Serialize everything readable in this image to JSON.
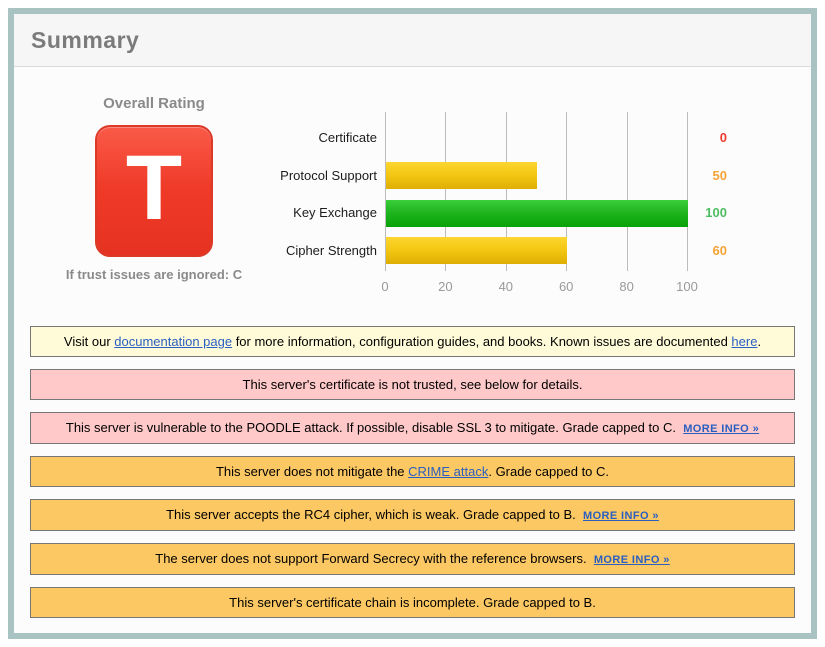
{
  "header": {
    "title": "Summary"
  },
  "rating": {
    "title": "Overall Rating",
    "grade": "T",
    "caption": "If trust issues are ignored: C",
    "badge_color_top": "#fa5a49",
    "badge_color_bottom": "#e63221"
  },
  "chart_data": {
    "type": "bar",
    "orientation": "horizontal",
    "categories": [
      "Certificate",
      "Protocol Support",
      "Key Exchange",
      "Cipher Strength"
    ],
    "values": [
      0,
      50,
      100,
      60
    ],
    "value_label_colors": [
      "#ee3b2c",
      "#f5a335",
      "#4cbd63",
      "#f5a335"
    ],
    "bar_styles": [
      "none",
      "yellow",
      "green",
      "yellow"
    ],
    "xticks": [
      0,
      20,
      40,
      60,
      80,
      100
    ],
    "xlim": [
      0,
      100
    ],
    "grid": true,
    "title": "",
    "xlabel": "",
    "ylabel": ""
  },
  "messages": [
    {
      "type": "info",
      "segments": [
        {
          "text": "Visit our "
        },
        {
          "text": "documentation page",
          "link": true
        },
        {
          "text": " for more information, configuration guides, and books. Known issues are documented "
        },
        {
          "text": "here",
          "link": true
        },
        {
          "text": "."
        }
      ]
    },
    {
      "type": "error",
      "segments": [
        {
          "text": "This server's certificate is not trusted, see below for details."
        }
      ]
    },
    {
      "type": "error",
      "segments": [
        {
          "text": "This server is vulnerable to the POODLE attack. If possible, disable SSL 3 to mitigate. Grade capped to C.  "
        },
        {
          "text": "MORE INFO »",
          "link": true,
          "more_info": true
        }
      ]
    },
    {
      "type": "warning",
      "segments": [
        {
          "text": "This server does not mitigate the "
        },
        {
          "text": "CRIME attack",
          "link": true
        },
        {
          "text": ". Grade capped to C."
        }
      ]
    },
    {
      "type": "warning",
      "segments": [
        {
          "text": "This server accepts the RC4 cipher, which is weak. Grade capped to B.  "
        },
        {
          "text": "MORE INFO »",
          "link": true,
          "more_info": true
        }
      ]
    },
    {
      "type": "warning",
      "segments": [
        {
          "text": "The server does not support Forward Secrecy with the reference browsers.  "
        },
        {
          "text": "MORE INFO »",
          "link": true,
          "more_info": true
        }
      ]
    },
    {
      "type": "warning",
      "segments": [
        {
          "text": "This server's certificate chain is incomplete. Grade capped to B."
        }
      ]
    }
  ],
  "colors": {
    "panel_border": "#a9c3c3",
    "header_bg": "#f6f6f6",
    "info_bg": "#fffbd8",
    "error_bg": "#ffc9c9",
    "warning_bg": "#fcc863",
    "link": "#2a5fc1",
    "gridline": "#bcbcbc"
  }
}
